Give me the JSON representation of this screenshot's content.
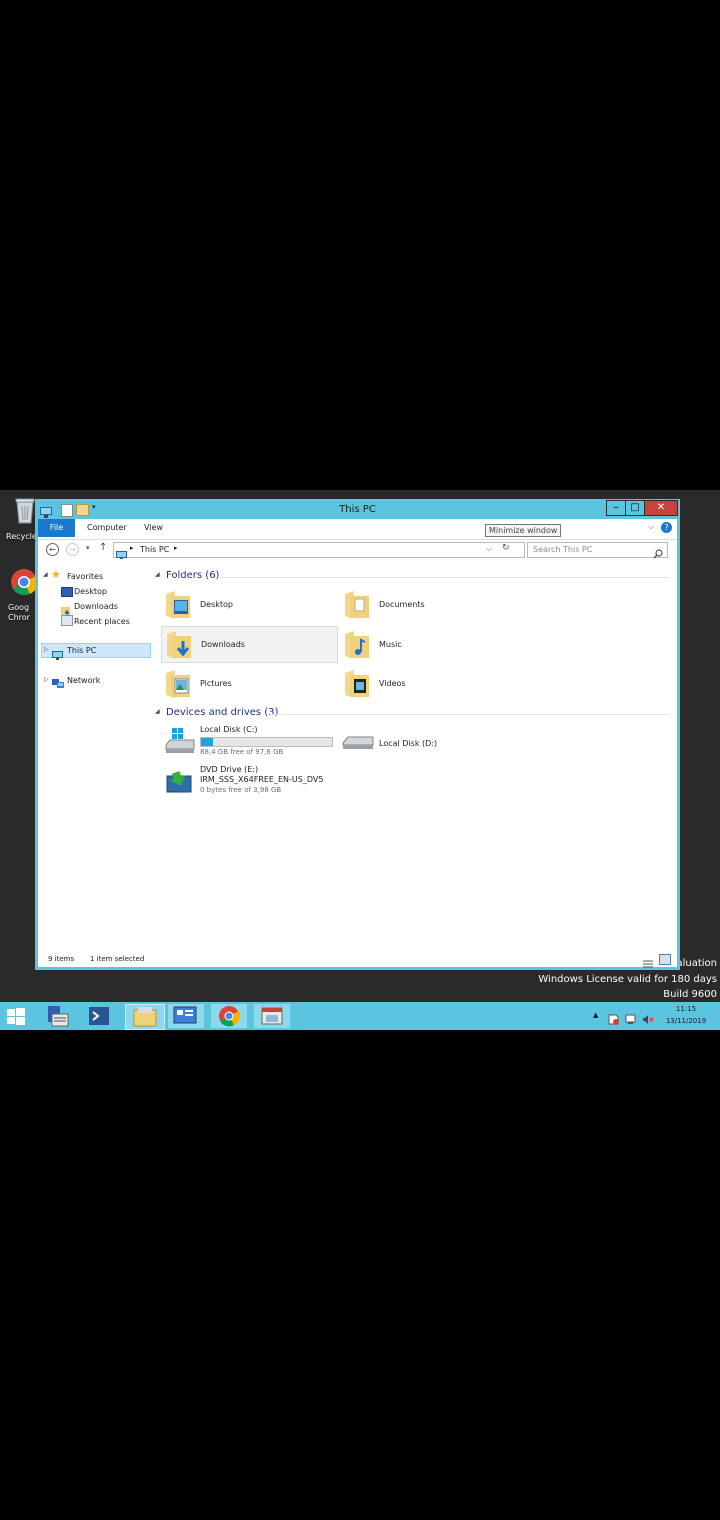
{
  "desktop": {
    "icons": [
      "Recycle",
      "Goog Chror"
    ],
    "watermark": {
      "line1": "aluation",
      "line2": "Windows License valid for 180 days",
      "line3": "Build 9600"
    }
  },
  "window": {
    "title": "This PC",
    "tooltip": "Minimize window",
    "ribbon": {
      "file": "File",
      "computer": "Computer",
      "view": "View"
    },
    "address": {
      "path": "This PC",
      "search_placeholder": "Search This PC"
    },
    "nav": {
      "favorites": "Favorites",
      "desktop": "Desktop",
      "downloads": "Downloads",
      "recent": "Recent places",
      "this_pc": "This PC",
      "network": "Network"
    },
    "folders": {
      "title": "Folders (6)",
      "items": [
        "Desktop",
        "Documents",
        "Downloads",
        "Music",
        "Pictures",
        "Videos"
      ]
    },
    "drives": {
      "title": "Devices and drives (3)",
      "c": {
        "name": "Local Disk (C:)",
        "free": "88,4 GB free of 97,6 GB",
        "used_fraction": 0.094
      },
      "d": {
        "name": "Local Disk (D:)"
      },
      "e": {
        "name": "DVD Drive (E:)",
        "label": "IRM_SSS_X64FREE_EN-US_DV5",
        "free": "0 bytes free of 3,98 GB"
      }
    },
    "status": {
      "count": "9 items",
      "selected": "1 item selected"
    }
  },
  "taskbar": {
    "time": "11:15",
    "date": "13/11/2019"
  },
  "colors": {
    "window": "#5bc5e0",
    "accent": "#1979ca",
    "close": "#c7433a"
  }
}
